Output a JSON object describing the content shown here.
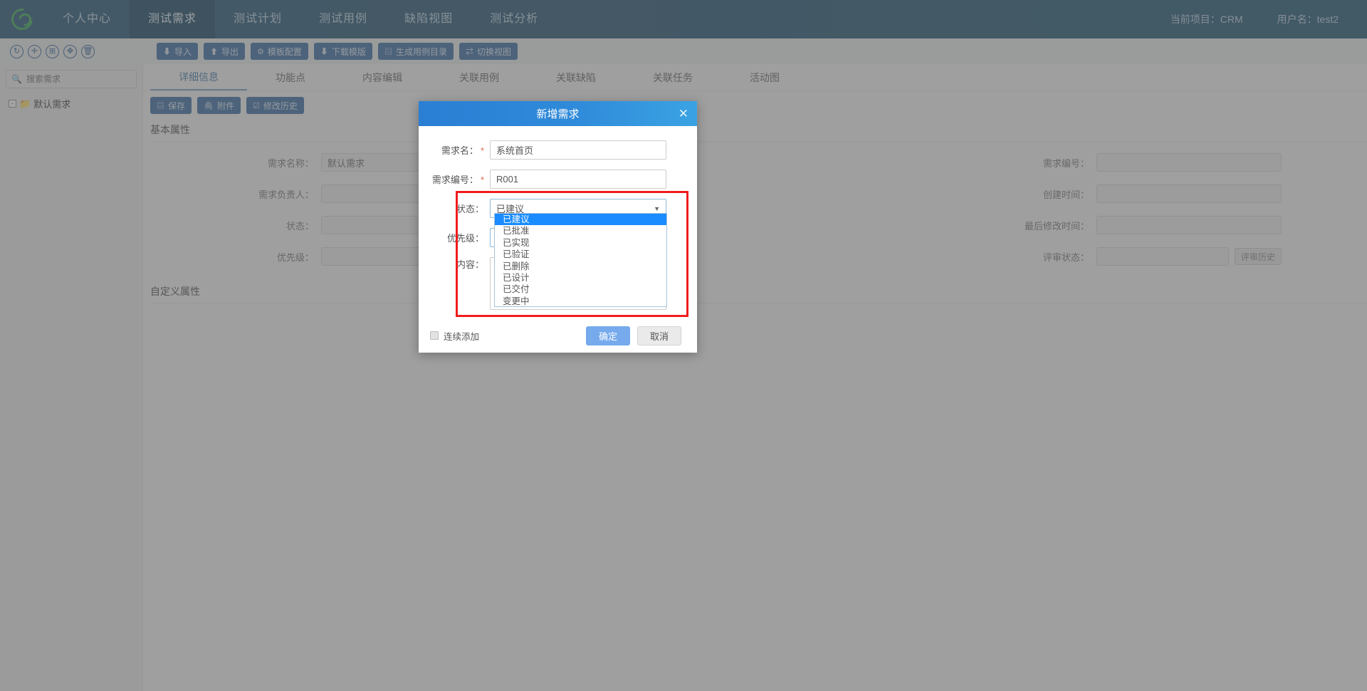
{
  "header": {
    "logo_icon": "spiral-logo-icon",
    "nav": [
      {
        "label": "个人中心",
        "active": false
      },
      {
        "label": "测试需求",
        "active": true
      },
      {
        "label": "测试计划",
        "active": false
      },
      {
        "label": "测试用例",
        "active": false
      },
      {
        "label": "缺陷视图",
        "active": false
      },
      {
        "label": "测试分析",
        "active": false
      }
    ],
    "current_project": "当前项目：CRM",
    "user_name": "用户名：test2",
    "bg_color": "#2b587a",
    "active_tab_color": "#1e4a66"
  },
  "tree_tools": [
    {
      "name": "refresh-icon",
      "glyph": "↻"
    },
    {
      "name": "add-icon",
      "glyph": "✛"
    },
    {
      "name": "copy-icon",
      "glyph": "⊞"
    },
    {
      "name": "move-icon",
      "glyph": "✥"
    },
    {
      "name": "delete-icon",
      "glyph": "🗑"
    }
  ],
  "toolbar": [
    {
      "label": "导入",
      "icon": "import-icon",
      "glyph": "⬇"
    },
    {
      "label": "导出",
      "icon": "export-icon",
      "glyph": "⬆"
    },
    {
      "label": "模板配置",
      "icon": "gear-icon",
      "glyph": "⚙"
    },
    {
      "label": "下载模版",
      "icon": "download-icon",
      "glyph": "⬇"
    },
    {
      "label": "生成用例目录",
      "icon": "list-icon",
      "glyph": "▤"
    },
    {
      "label": "切换视图",
      "icon": "swap-icon",
      "glyph": "⇄"
    }
  ],
  "sidebar": {
    "search": {
      "placeholder": "搜索需求",
      "value": "",
      "icon": "search-icon"
    },
    "tree": [
      {
        "label": "默认需求",
        "expander": "-",
        "icon": "folder-icon"
      }
    ]
  },
  "main": {
    "tabs": [
      {
        "label": "详细信息",
        "active": true
      },
      {
        "label": "功能点",
        "active": false
      },
      {
        "label": "内容编辑",
        "active": false
      },
      {
        "label": "关联用例",
        "active": false
      },
      {
        "label": "关联缺陷",
        "active": false
      },
      {
        "label": "关联任务",
        "active": false
      },
      {
        "label": "活动图",
        "active": false
      }
    ],
    "action_buttons": [
      {
        "label": "保存",
        "icon": "save-icon",
        "glyph": "▤"
      },
      {
        "label": "附件",
        "icon": "paperclip-icon",
        "glyph": "🖇"
      },
      {
        "label": "修改历史",
        "icon": "edit-history-icon",
        "glyph": "☑"
      }
    ],
    "basic_section_title": "基本属性",
    "custom_section_title": "自定义属性",
    "fields": {
      "req_name_label": "需求名称：",
      "req_name_value": "默认需求",
      "req_owner_label": "需求负责人：",
      "req_owner_value": "",
      "req_owner_picker_icon": "user-picker-icon",
      "status_label": "状态：",
      "status_value": "",
      "priority_label": "优先级：",
      "priority_value": "",
      "req_code_label": "需求编号：",
      "req_code_value": "",
      "create_time_label": "创建时间：",
      "create_time_value": "",
      "last_modified_label": "最后修改时间：",
      "last_modified_value": "",
      "review_status_label": "评审状态：",
      "review_status_value": "",
      "review_history_button": "评审历史"
    }
  },
  "modal": {
    "title": "新增需求",
    "close_icon": "close-icon",
    "header_color": "#2f8ad9",
    "fields": {
      "name_label": "需求名：",
      "name_required": "*",
      "name_value": "系统首页",
      "code_label": "需求编号：",
      "code_required": "*",
      "code_value": "R001",
      "status_label": "状态：",
      "status_value": "已建议",
      "status_caret_icon": "chevron-down-icon",
      "priority_label": "优先级：",
      "priority_value": "",
      "content_label": "内容：",
      "content_value": ""
    },
    "status_options": [
      {
        "label": "已建议",
        "selected": true
      },
      {
        "label": "已批准",
        "selected": false
      },
      {
        "label": "已实现",
        "selected": false
      },
      {
        "label": "已验证",
        "selected": false
      },
      {
        "label": "已删除",
        "selected": false
      },
      {
        "label": "已设计",
        "selected": false
      },
      {
        "label": "已交付",
        "selected": false
      },
      {
        "label": "变更中",
        "selected": false
      }
    ],
    "footer": {
      "continuous_add_label": "连续添加",
      "continuous_add_checked": false,
      "confirm_label": "确定",
      "cancel_label": "取消"
    },
    "highlight_color": "#f01c1c"
  }
}
